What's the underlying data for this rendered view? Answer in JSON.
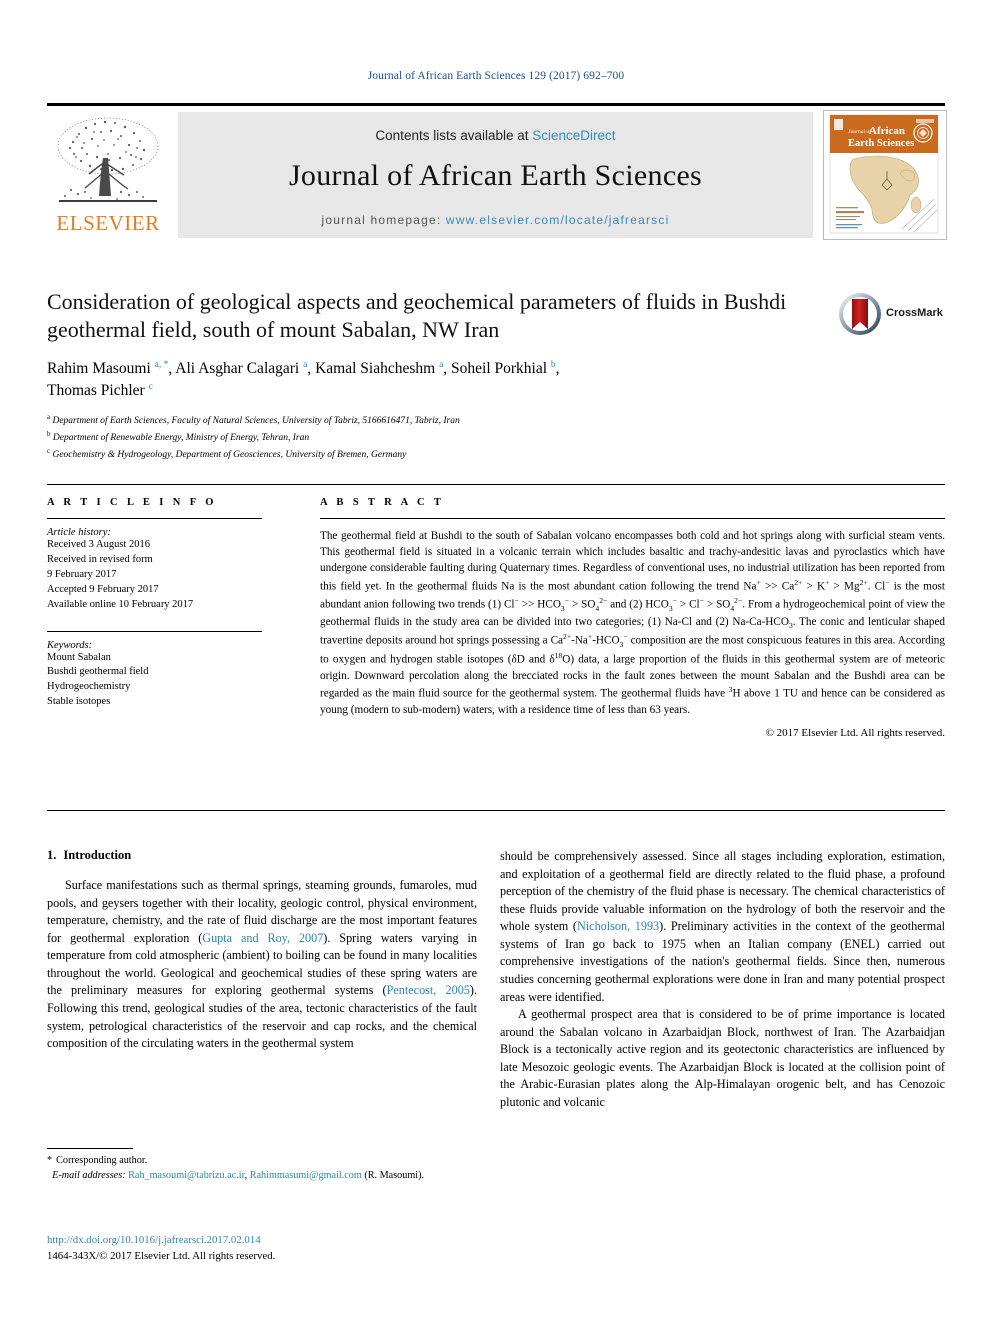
{
  "running_head": "Journal of African Earth Sciences 129 (2017) 692–700",
  "masthead": {
    "publisher_name": "ELSEVIER",
    "contents_prefix": "Contents lists available at",
    "sciencedirect": "ScienceDirect",
    "journal_title": "Journal of African Earth Sciences",
    "homepage_prefix": "journal homepage:",
    "homepage_url": "www.elsevier.com/locate/jafrearsci",
    "cover": {
      "line1": "Journal of",
      "line2": "African",
      "line3": "Earth Sciences",
      "band_color": "#c96a1e",
      "map_color": "#e8d3a8"
    }
  },
  "crossmark": {
    "label": "CrossMark"
  },
  "article": {
    "title": "Consideration of geological aspects and geochemical parameters of fluids in Bushdi geothermal field, south of mount Sabalan, NW Iran",
    "authors_line1": "Rahim Masoumi a, *, Ali Asghar Calagari a, Kamal Siahcheshm a, Soheil Porkhial b,",
    "authors_line2": "Thomas Pichler c",
    "authors": [
      {
        "name": "Rahim Masoumi",
        "marks": "a, *"
      },
      {
        "name": "Ali Asghar Calagari",
        "marks": "a"
      },
      {
        "name": "Kamal Siahcheshm",
        "marks": "a"
      },
      {
        "name": "Soheil Porkhial",
        "marks": "b"
      },
      {
        "name": "Thomas Pichler",
        "marks": "c"
      }
    ],
    "affiliations": [
      {
        "mark": "a",
        "text": "Department of Earth Sciences, Faculty of Natural Sciences, University of Tabriz, 5166616471, Tabriz, Iran"
      },
      {
        "mark": "b",
        "text": "Department of Renewable Energy, Ministry of Energy, Tehran, Iran"
      },
      {
        "mark": "c",
        "text": "Geochemistry & Hydrogeology, Department of Geosciences, University of Bremen, Germany"
      }
    ]
  },
  "article_info": {
    "heading": "A R T I C L E   I N F O",
    "history_label": "Article history:",
    "history": [
      "Received 3 August 2016",
      "Received in revised form",
      "9 February 2017",
      "Accepted 9 February 2017",
      "Available online 10 February 2017"
    ],
    "keywords_label": "Keywords:",
    "keywords": [
      "Mount Sabalan",
      "Bushdi geothermal field",
      "Hydrogeochemistry",
      "Stable isotopes"
    ]
  },
  "abstract": {
    "heading": "A B S T R A C T",
    "text_p1": "The geothermal field at Bushdi to the south of Sabalan volcano encompasses both cold and hot springs along with surficial steam vents. This geothermal field is situated in a volcanic terrain which includes basaltic and trachy-andesitic lavas and pyroclastics which have undergone considerable faulting during Quaternary times. Regardless of conventional uses, no industrial utilization has been reported from this field yet. In the geothermal fluids Na is the most abundant cation following the trend Na",
    "seg_a": " >> Ca",
    "seg_b": " > K",
    "seg_c": " > Mg",
    "seg_d": ". Cl",
    "seg_e": " is the most abundant anion following two trends (1) Cl",
    "seg_f": " >> HCO",
    "seg_g": " > SO",
    "seg_h": " and (2) HCO",
    "seg_i": " > Cl",
    "seg_j": " > SO",
    "seg_k": ". From a hydrogeochemical point of view the geothermal fluids in the study area can be divided into two categories; (1) Na-Cl and (2) Na-Ca-HCO",
    "seg_l": ". The conic and lenticular shaped travertine deposits around hot springs possessing a Ca",
    "seg_m": "-Na",
    "seg_n": "-HCO",
    "seg_o": " composition are the most conspicuous features in this area. According to oxygen and hydrogen stable isotopes (δD and δ",
    "seg_p": "O) data, a large proportion of the fluids in this geothermal system are of meteoric origin. Downward percolation along the brecciated rocks in the fault zones between the mount Sabalan and the Bushdi area can be regarded as the main fluid source for the geothermal system. The geothermal fluids have ",
    "seg_q": "H above 1 TU and hence can be considered as young (modern to sub-modern) waters, with a residence time of less than 63 years.",
    "copyright": "© 2017 Elsevier Ltd. All rights reserved."
  },
  "introduction": {
    "heading_num": "1.",
    "heading_text": "Introduction",
    "left_p1_a": "Surface manifestations such as thermal springs, steaming grounds, fumaroles, mud pools, and geysers together with their locality, geologic control, physical environment, temperature, chemistry, and the rate of fluid discharge are the most important features for geothermal exploration (",
    "left_cite1": "Gupta and Roy, 2007",
    "left_p1_b": "). Spring waters varying in temperature from cold atmospheric (ambient) to boiling can be found in many localities throughout the world. Geological and geochemical studies of these spring waters are the preliminary measures for exploring geothermal systems (",
    "left_cite2": "Pentecost, 2005",
    "left_p1_c": "). Following this trend, geological studies of the area, tectonic characteristics of the fault system, petrological characteristics of the reservoir and cap rocks, and the chemical composition of the circulating waters in the geothermal system",
    "right_p1_a": "should be comprehensively assessed. Since all stages including exploration, estimation, and exploitation of a geothermal field are directly related to the fluid phase, a profound perception of the chemistry of the fluid phase is necessary. The chemical characteristics of these fluids provide valuable information on the hydrology of both the reservoir and the whole system (",
    "right_cite1": "Nicholson, 1993",
    "right_p1_b": "). Preliminary activities in the context of the geothermal systems of Iran go back to 1975 when an Italian company (ENEL) carried out comprehensive investigations of the nation's geothermal fields. Since then, numerous studies concerning geothermal explorations were done in Iran and many potential prospect areas were identified.",
    "right_p2": "A geothermal prospect area that is considered to be of prime importance is located around the Sabalan volcano in Azarbaidjan Block, northwest of Iran. The Azarbaidjan Block is a tectonically active region and its geotectonic characteristics are influenced by late Mesozoic geologic events. The Azarbaidjan Block is located at the collision point of the Arabic-Eurasian plates along the Alp-Himalayan orogenic belt, and has Cenozoic plutonic and volcanic"
  },
  "footnote": {
    "star": "*",
    "corresponding": "Corresponding author.",
    "email_label": "E-mail addresses:",
    "email1": "Rah_masoumi@tabrizu.ac.ir",
    "email_sep": ",",
    "email2": "Rahimmasumi@gmail.com",
    "email_owner": "(R. Masoumi)."
  },
  "doi_block": {
    "doi": "http://dx.doi.org/10.1016/j.jafrearsci.2017.02.014",
    "issn_line": "1464-343X/© 2017 Elsevier Ltd. All rights reserved."
  },
  "colors": {
    "link": "#2e86ab",
    "running_head": "#1a4f9c",
    "elsevier_orange": "#e87b22",
    "banner_bg": "#e7e7e7"
  }
}
